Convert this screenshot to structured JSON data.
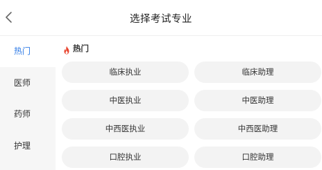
{
  "header": {
    "title": "选择考试专业"
  },
  "sidebar": {
    "items": [
      {
        "label": "热门"
      },
      {
        "label": "医师"
      },
      {
        "label": "药师"
      },
      {
        "label": "护理"
      }
    ]
  },
  "section": {
    "label": "热门"
  },
  "options": [
    {
      "label": "临床执业"
    },
    {
      "label": "临床助理"
    },
    {
      "label": "中医执业"
    },
    {
      "label": "中医助理"
    },
    {
      "label": "中西医执业"
    },
    {
      "label": "中西医助理"
    },
    {
      "label": "口腔执业"
    },
    {
      "label": "口腔助理"
    }
  ],
  "colors": {
    "accent": "#2f7be6",
    "fire": "#e8432d",
    "chip_bg": "#f3f3f3",
    "sidebar_bg": "#f6f6f6"
  }
}
